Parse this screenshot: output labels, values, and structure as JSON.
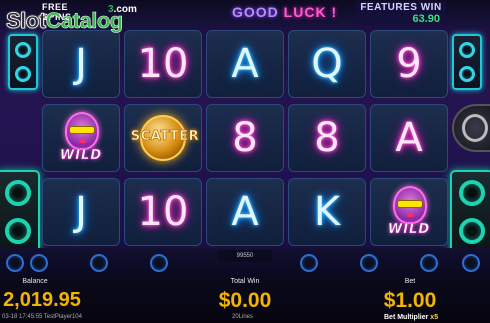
{
  "header": {
    "free_spins_line1": "FREE",
    "free_spins_line2": "SPINS",
    "good_luck_word1": "GOOD",
    "good_luck_word2": "LUCK",
    "good_luck_punct": "!",
    "features_win_label": "FEATURES WIN",
    "features_win_value": "63.90"
  },
  "logo": {
    "part1": "Slot",
    "part2": "Catalog",
    "badge_prefix": "",
    "badge_mid": "3",
    "badge_suffix": ".com"
  },
  "reels": {
    "rows": [
      [
        "J",
        "10",
        "A",
        "Q",
        "9"
      ],
      [
        "WILD",
        "SCATTER",
        "8",
        "8",
        "A"
      ],
      [
        "J",
        "10",
        "A",
        "K",
        "WILD"
      ]
    ],
    "colors": [
      [
        "blue",
        "pink",
        "blue",
        "blue",
        "pink"
      ],
      [
        "wild",
        "scatter",
        "pink",
        "pink",
        "pink"
      ],
      [
        "blue",
        "pink",
        "blue",
        "blue",
        "wild"
      ]
    ]
  },
  "lines_tag": "99550",
  "footer": {
    "balance_label": "Balance",
    "balance_value": "2,019.95",
    "total_win_label": "Total Win",
    "total_win_value": "$0.00",
    "lines_text": "20Lines",
    "bet_label": "Bet",
    "bet_value": "$1.00",
    "bet_multiplier_label": "Bet Multiplier",
    "bet_multiplier_value": "x5",
    "session_info": "03-18 17:45:55  TestPlayer104"
  },
  "accent_colors": {
    "gold": "#f4b400",
    "neon_blue": "#3fc8ff",
    "neon_pink": "#ff5fe0",
    "win_green": "#38e07a"
  }
}
